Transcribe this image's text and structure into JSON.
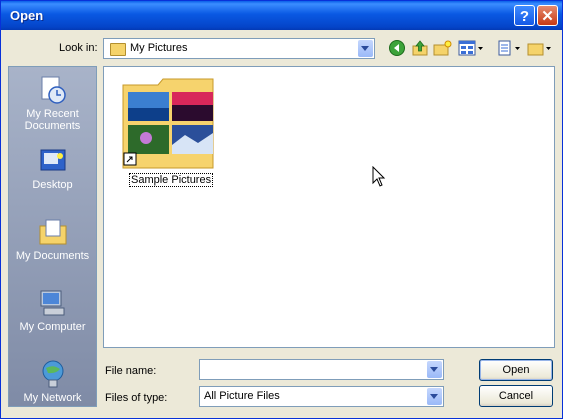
{
  "window": {
    "title": "Open",
    "help_glyph": "?",
    "close_glyph": "✕"
  },
  "lookin": {
    "label": "Look in:",
    "value": "My Pictures"
  },
  "places": [
    {
      "line1": "My Recent",
      "line2": "Documents",
      "icon": "recent-documents-icon"
    },
    {
      "line1": "Desktop",
      "line2": "",
      "icon": "desktop-icon"
    },
    {
      "line1": "My Documents",
      "line2": "",
      "icon": "my-documents-icon"
    },
    {
      "line1": "My Computer",
      "line2": "",
      "icon": "my-computer-icon"
    },
    {
      "line1": "My Network",
      "line2": "",
      "icon": "my-network-icon"
    }
  ],
  "files": [
    {
      "name": "Sample Pictures",
      "icon": "folder-thumbnail-icon"
    }
  ],
  "filename": {
    "label": "File name:",
    "value": ""
  },
  "filetype": {
    "label": "Files of type:",
    "value": "All Picture Files"
  },
  "buttons": {
    "open": "Open",
    "cancel": "Cancel"
  },
  "colors": {
    "titlebar": "#0a59e3",
    "dialog_bg": "#ece9d8",
    "places_bar": "#8f9ab4"
  }
}
